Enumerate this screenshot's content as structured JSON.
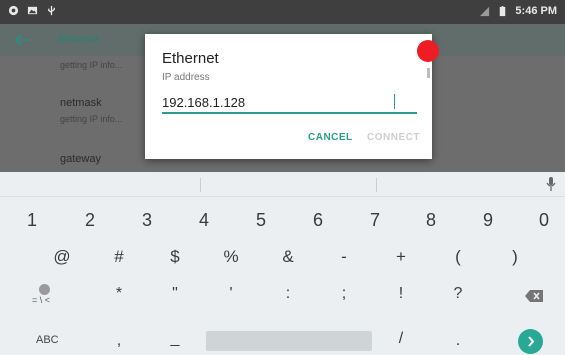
{
  "status_bar": {
    "time": "5:46 PM"
  },
  "app_bar": {
    "title": "Ethernet"
  },
  "settings_list": {
    "item0_summary": "getting IP info...",
    "netmask_title": "netmask",
    "netmask_summary": "getting IP info...",
    "gateway_title": "gateway"
  },
  "dialog": {
    "title": "Ethernet",
    "field_label": "IP address",
    "field_value": "192.168.1.128",
    "cancel_label": "CANCEL",
    "connect_label": "CONNECT"
  },
  "keyboard": {
    "row1": [
      "1",
      "2",
      "3",
      "4",
      "5",
      "6",
      "7",
      "8",
      "9",
      "0"
    ],
    "row2": [
      "@",
      "#",
      "$",
      "%",
      "&",
      "-",
      "+",
      "(",
      ")"
    ],
    "row3": [
      "*",
      "\"",
      "'",
      ":",
      ";",
      "!",
      "?"
    ],
    "emoji_symbol": "= \\ <",
    "row4_abc": "ABC",
    "row4_left": ",",
    "row4_underscore": "_",
    "row4_slash": "/",
    "row4_period": "."
  },
  "colors": {
    "accent": "#2a9c8e",
    "marker": "#ee1c24"
  },
  "icons": [
    "settings-icon",
    "image-icon",
    "usb-icon",
    "signal-icon",
    "battery-icon",
    "back-arrow-icon",
    "mic-icon",
    "emoji-icon",
    "backspace-icon",
    "go-icon"
  ]
}
